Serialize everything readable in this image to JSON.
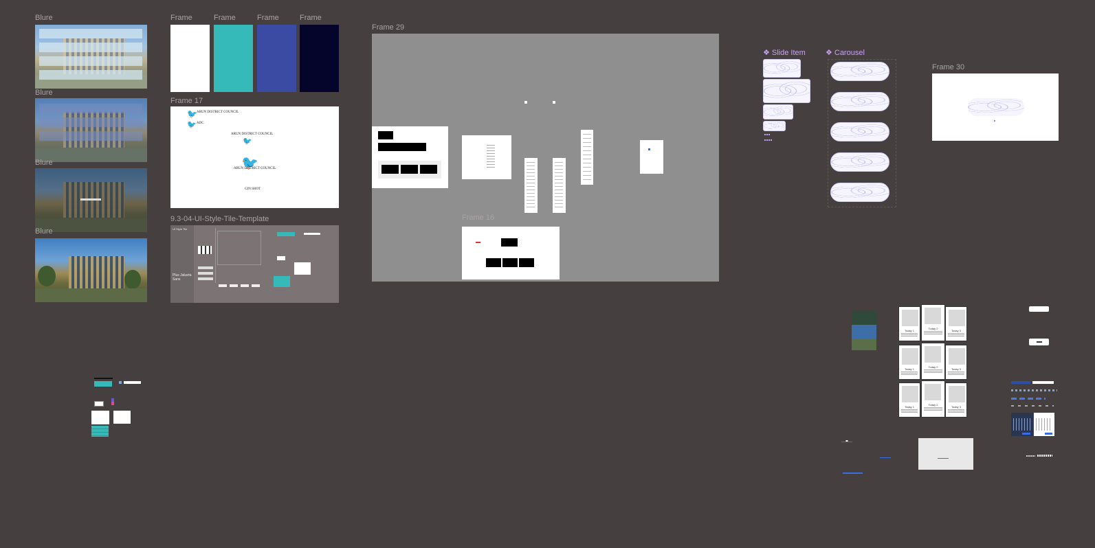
{
  "labels": {
    "blure_1": "Blure",
    "blure_2": "Blure",
    "blure_3": "Blure",
    "blure_4": "Blure",
    "frame_1": "Frame",
    "frame_2": "Frame",
    "frame_3": "Frame",
    "frame_4": "Frame",
    "frame_17": "Frame 17",
    "style_tile": "9.3-04-UI-Style-Tile-Template",
    "frame_29": "Frame 29",
    "frame_16": "Frame 16",
    "slide_item": "Slide Item",
    "carousel": "Carousel",
    "frame_30": "Frame 30"
  },
  "swatches": {
    "white": "#ffffff",
    "teal": "#35b9b9",
    "blue": "#3b4ba3",
    "navy": "#05042a"
  },
  "frame17": {
    "line1": "ARUN DISTRICT COUNCIL",
    "line2": "ADC",
    "line3": "ARUN DISTRICT COUNCIL",
    "line4": "ARUN DISTRICT COUNCIL",
    "line5": "GIN SHOT"
  },
  "style_tile": {
    "heading": "UI Style Tile",
    "headline": "Plus Jakarta Sans"
  },
  "cards": [
    {
      "title": "Today 1"
    },
    {
      "title": "Today 2"
    },
    {
      "title": "Today 3"
    },
    {
      "title": "Today 1"
    },
    {
      "title": "Today 2"
    },
    {
      "title": "Today 3"
    },
    {
      "title": "Today 1"
    },
    {
      "title": "Today 2"
    },
    {
      "title": "Today 3"
    }
  ],
  "colors": {
    "canvas": "#453f3f",
    "component": "#c9a4f2",
    "frame_gray": "#8f8f8f"
  }
}
